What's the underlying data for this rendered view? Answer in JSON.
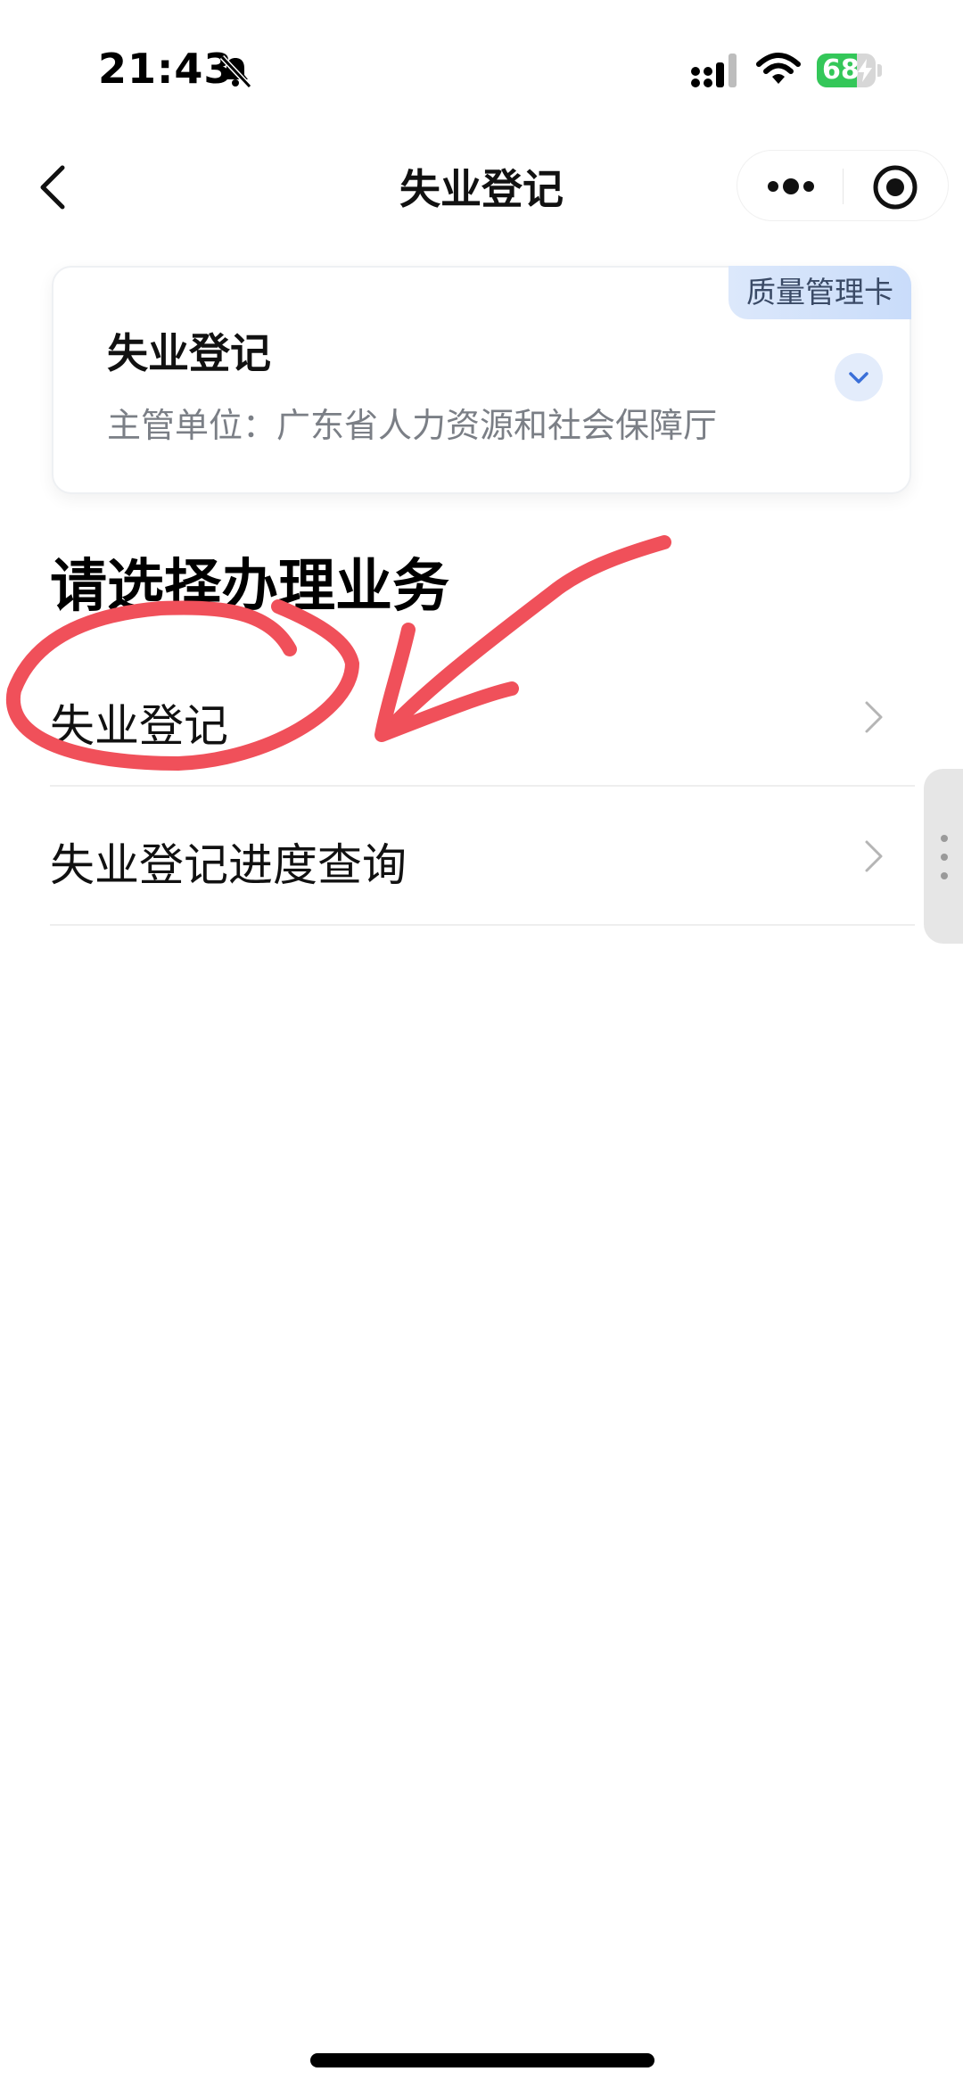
{
  "status_bar": {
    "time": "21:43",
    "battery_level": "68",
    "battery_fraction": 0.68,
    "icons": [
      "bell-mute-icon",
      "signal-icon",
      "wifi-icon",
      "battery-icon"
    ]
  },
  "nav": {
    "title": "失业登记",
    "back_icon": "chevron-left-icon",
    "more_icon": "more-dots-icon",
    "close_icon": "target-icon"
  },
  "card": {
    "badge": "质量管理卡",
    "title": "失业登记",
    "subtitle": "主管单位：广东省人力资源和社会保障厅",
    "toggle_icon": "chevron-down-icon"
  },
  "section": {
    "heading": "请选择办理业务",
    "items": [
      {
        "label": "失业登记"
      },
      {
        "label": "失业登记进度查询"
      }
    ]
  },
  "colors": {
    "accent": "#3a6fd8",
    "annotation": "#f0505a",
    "battery": "#34c759",
    "muted_text": "#7b7f86"
  }
}
